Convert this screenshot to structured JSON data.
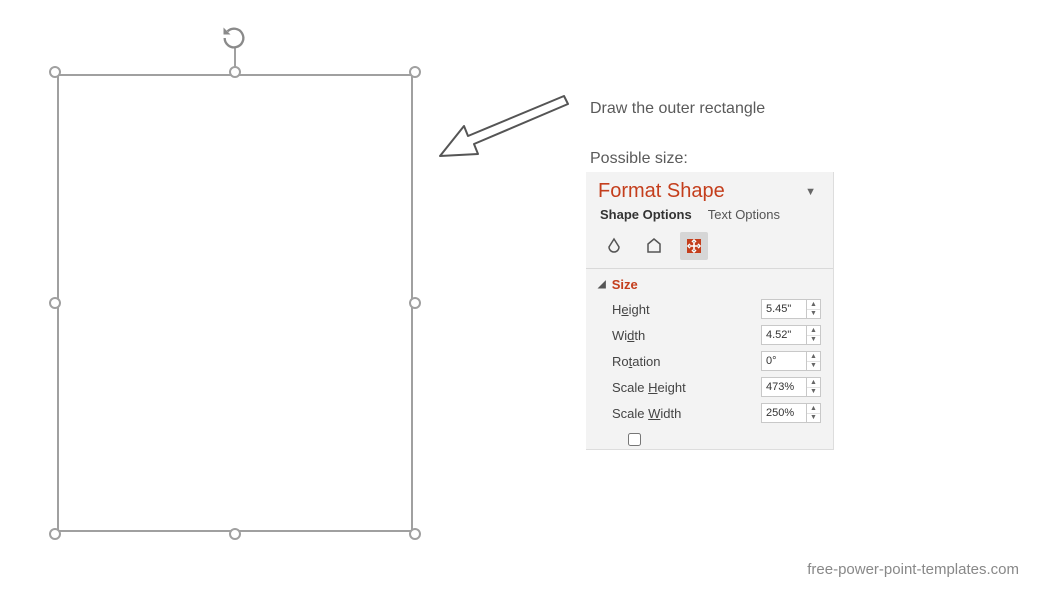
{
  "instructions": {
    "line1": "Draw the outer rectangle",
    "line2": "Possible size:"
  },
  "format_pane": {
    "title": "Format Shape",
    "tabs": {
      "shape_options": "Shape Options",
      "text_options": "Text Options"
    },
    "section": {
      "size_label": "Size",
      "height_label": "Height",
      "width_label": "Width",
      "rotation_label": "Rotation",
      "scale_height_label": "Scale Height",
      "scale_width_label": "Scale Width",
      "height_value": "5.45\"",
      "width_value": "4.52\"",
      "rotation_value": "0°",
      "scale_height_value": "473%",
      "scale_width_value": "250%"
    }
  },
  "watermark": "free-power-point-templates.com"
}
